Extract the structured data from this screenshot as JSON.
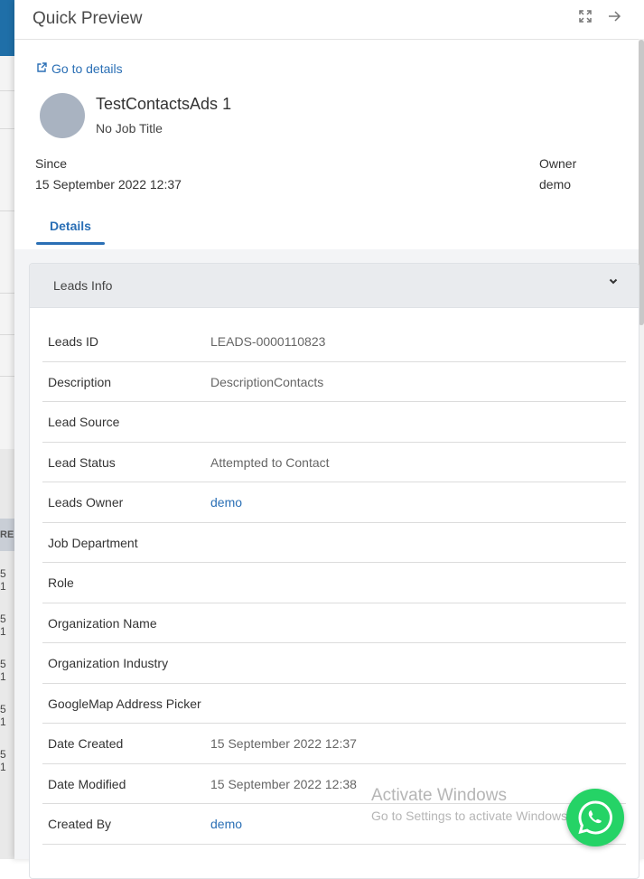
{
  "background": {
    "table_header_fragment": "RE",
    "row_fragments": [
      "5 1",
      "5 1",
      "5 1",
      "5 1",
      "5 1"
    ]
  },
  "header": {
    "title": "Quick Preview",
    "icons": {
      "expand": "expand-icon",
      "close": "arrow-right-icon"
    }
  },
  "preview": {
    "goto_label": "Go to details",
    "name": "TestContactsAds 1",
    "job_title": "No Job Title",
    "since_label": "Since",
    "since_value": "15 September 2022 12:37",
    "owner_label": "Owner",
    "owner_value": "demo"
  },
  "tabs": [
    {
      "label": "Details",
      "active": true
    }
  ],
  "section": {
    "title": "Leads Info",
    "rows": [
      {
        "label": "Leads ID",
        "value": "LEADS-0000110823",
        "link": false
      },
      {
        "label": "Description",
        "value": "DescriptionContacts",
        "link": false
      },
      {
        "label": "Lead Source",
        "value": "",
        "link": false
      },
      {
        "label": "Lead Status",
        "value": "Attempted to Contact",
        "link": false
      },
      {
        "label": "Leads Owner",
        "value": "demo",
        "link": true
      },
      {
        "label": "Job Department",
        "value": "",
        "link": false
      },
      {
        "label": "Role",
        "value": "",
        "link": false
      },
      {
        "label": "Organization Name",
        "value": "",
        "link": false
      },
      {
        "label": "Organization Industry",
        "value": "",
        "link": false
      },
      {
        "label": "GoogleMap Address Picker",
        "value": "",
        "link": false
      },
      {
        "label": "Date Created",
        "value": "15 September 2022 12:37",
        "link": false
      },
      {
        "label": "Date Modified",
        "value": "15 September 2022 12:38",
        "link": false
      },
      {
        "label": "Created By",
        "value": "demo",
        "link": true
      }
    ]
  },
  "watermark": {
    "title": "Activate Windows",
    "subtitle": "Go to Settings to activate Windows."
  },
  "colors": {
    "accent": "#2a6fb5",
    "whatsapp": "#25d366",
    "avatar": "#a9b3c1"
  }
}
